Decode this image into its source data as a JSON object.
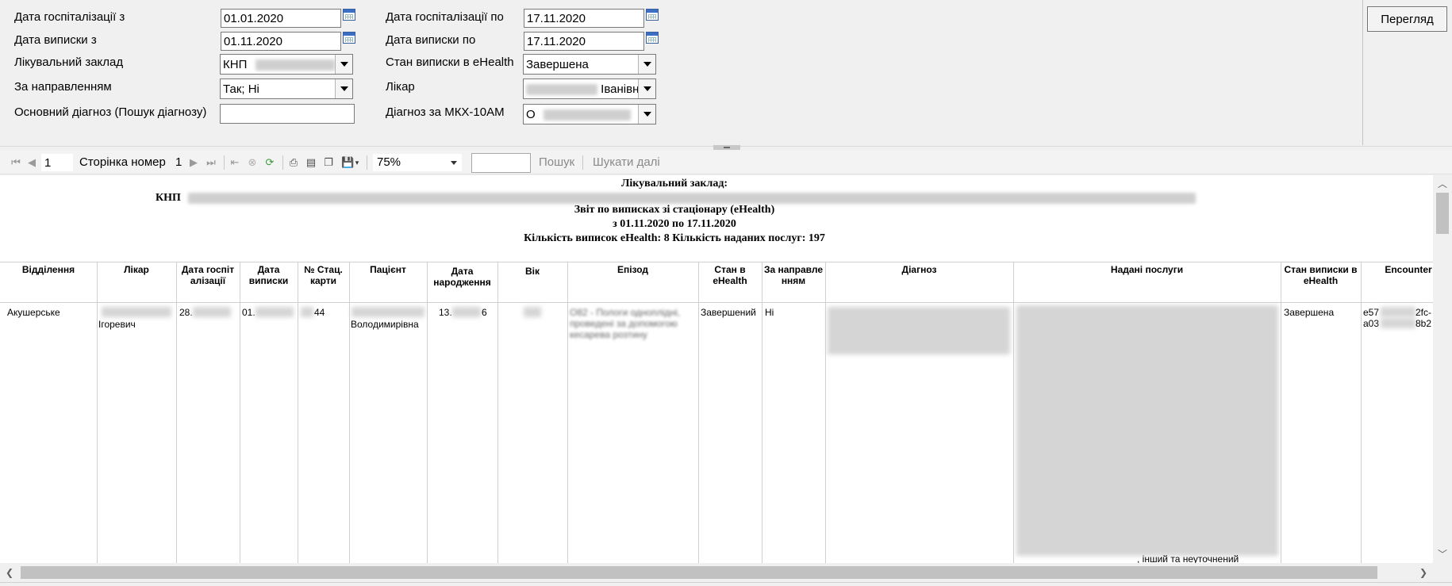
{
  "filters": {
    "hosp_from_label": "Дата госпіталізації з",
    "hosp_from_value": "01.01.2020",
    "hosp_to_label": "Дата госпіталізації по",
    "hosp_to_value": "17.11.2020",
    "discharge_from_label": "Дата виписки з",
    "discharge_from_value": "01.11.2020",
    "discharge_to_label": "Дата виписки по",
    "discharge_to_value": "17.11.2020",
    "facility_label": "Лікувальний заклад",
    "facility_value": "КНП",
    "ehealth_status_label": "Стан виписки в eHealth",
    "ehealth_status_value": "Завершена",
    "referral_label": "За направленням",
    "referral_value": "Так; Ні",
    "doctor_label": "Лікар",
    "doctor_value": "Іванівн",
    "main_diagnosis_label": "Основний діагноз (Пошук діагнозу)",
    "main_diagnosis_value": "",
    "icd_label": "Діагноз за МКХ-10АМ",
    "icd_value": "O"
  },
  "view_button_label": "Перегляд",
  "toolbar": {
    "page_value": "1",
    "page_label": "Сторінка номер",
    "page_total": "1",
    "zoom_value": "75%",
    "search_label": "Пошук",
    "search_next_label": "Шукати далі",
    "icons": [
      "first-page-icon",
      "prev-page-icon",
      "next-page-icon",
      "last-page-icon",
      "back-icon",
      "stop-icon",
      "refresh-icon",
      "print-icon",
      "print-layout-icon",
      "page-setup-icon",
      "export-icon"
    ]
  },
  "report": {
    "facility_heading": "Лікувальний заклад:",
    "facility_name": "КНП",
    "title": "Звіт по виписках зі стаціонару (eHealth)",
    "period": "з 01.11.2020 по 17.11.2020",
    "summary": "Кількість виписок  eHealth: 8   Кількість наданих послуг: 197",
    "columns": [
      "Відділення",
      "Лікар",
      "Дата госпіталізації",
      "Дата виписки",
      "№ Стац. карти",
      "Пацієнт",
      "Дата народження",
      "Вік",
      "Епізод",
      "Стан в eHealth",
      "За направленням",
      "Діагноз",
      "Надані послуги",
      "Стан виписки в eHealth",
      "Encounter"
    ],
    "row": {
      "department": "Акушерське",
      "doctor": "Ігоревич",
      "hosp_date": "28.",
      "discharge_date": "01.",
      "card_no": "44",
      "patient": "Володимирівна",
      "birth_date_start": "13.",
      "birth_date_end": "6",
      "episode": "O82 - Пологи одноплідні, проведені за допомогою кесарева розтину",
      "ehealth_state": "Завершений",
      "referral": "Ні",
      "services_tail": ", інший та неуточнений",
      "discharge_state": "Завершена",
      "encounter_line1_a": "e57",
      "encounter_line1_b": "2fc-",
      "encounter_line2_a": "a03",
      "encounter_line2_b": "8b2"
    }
  }
}
